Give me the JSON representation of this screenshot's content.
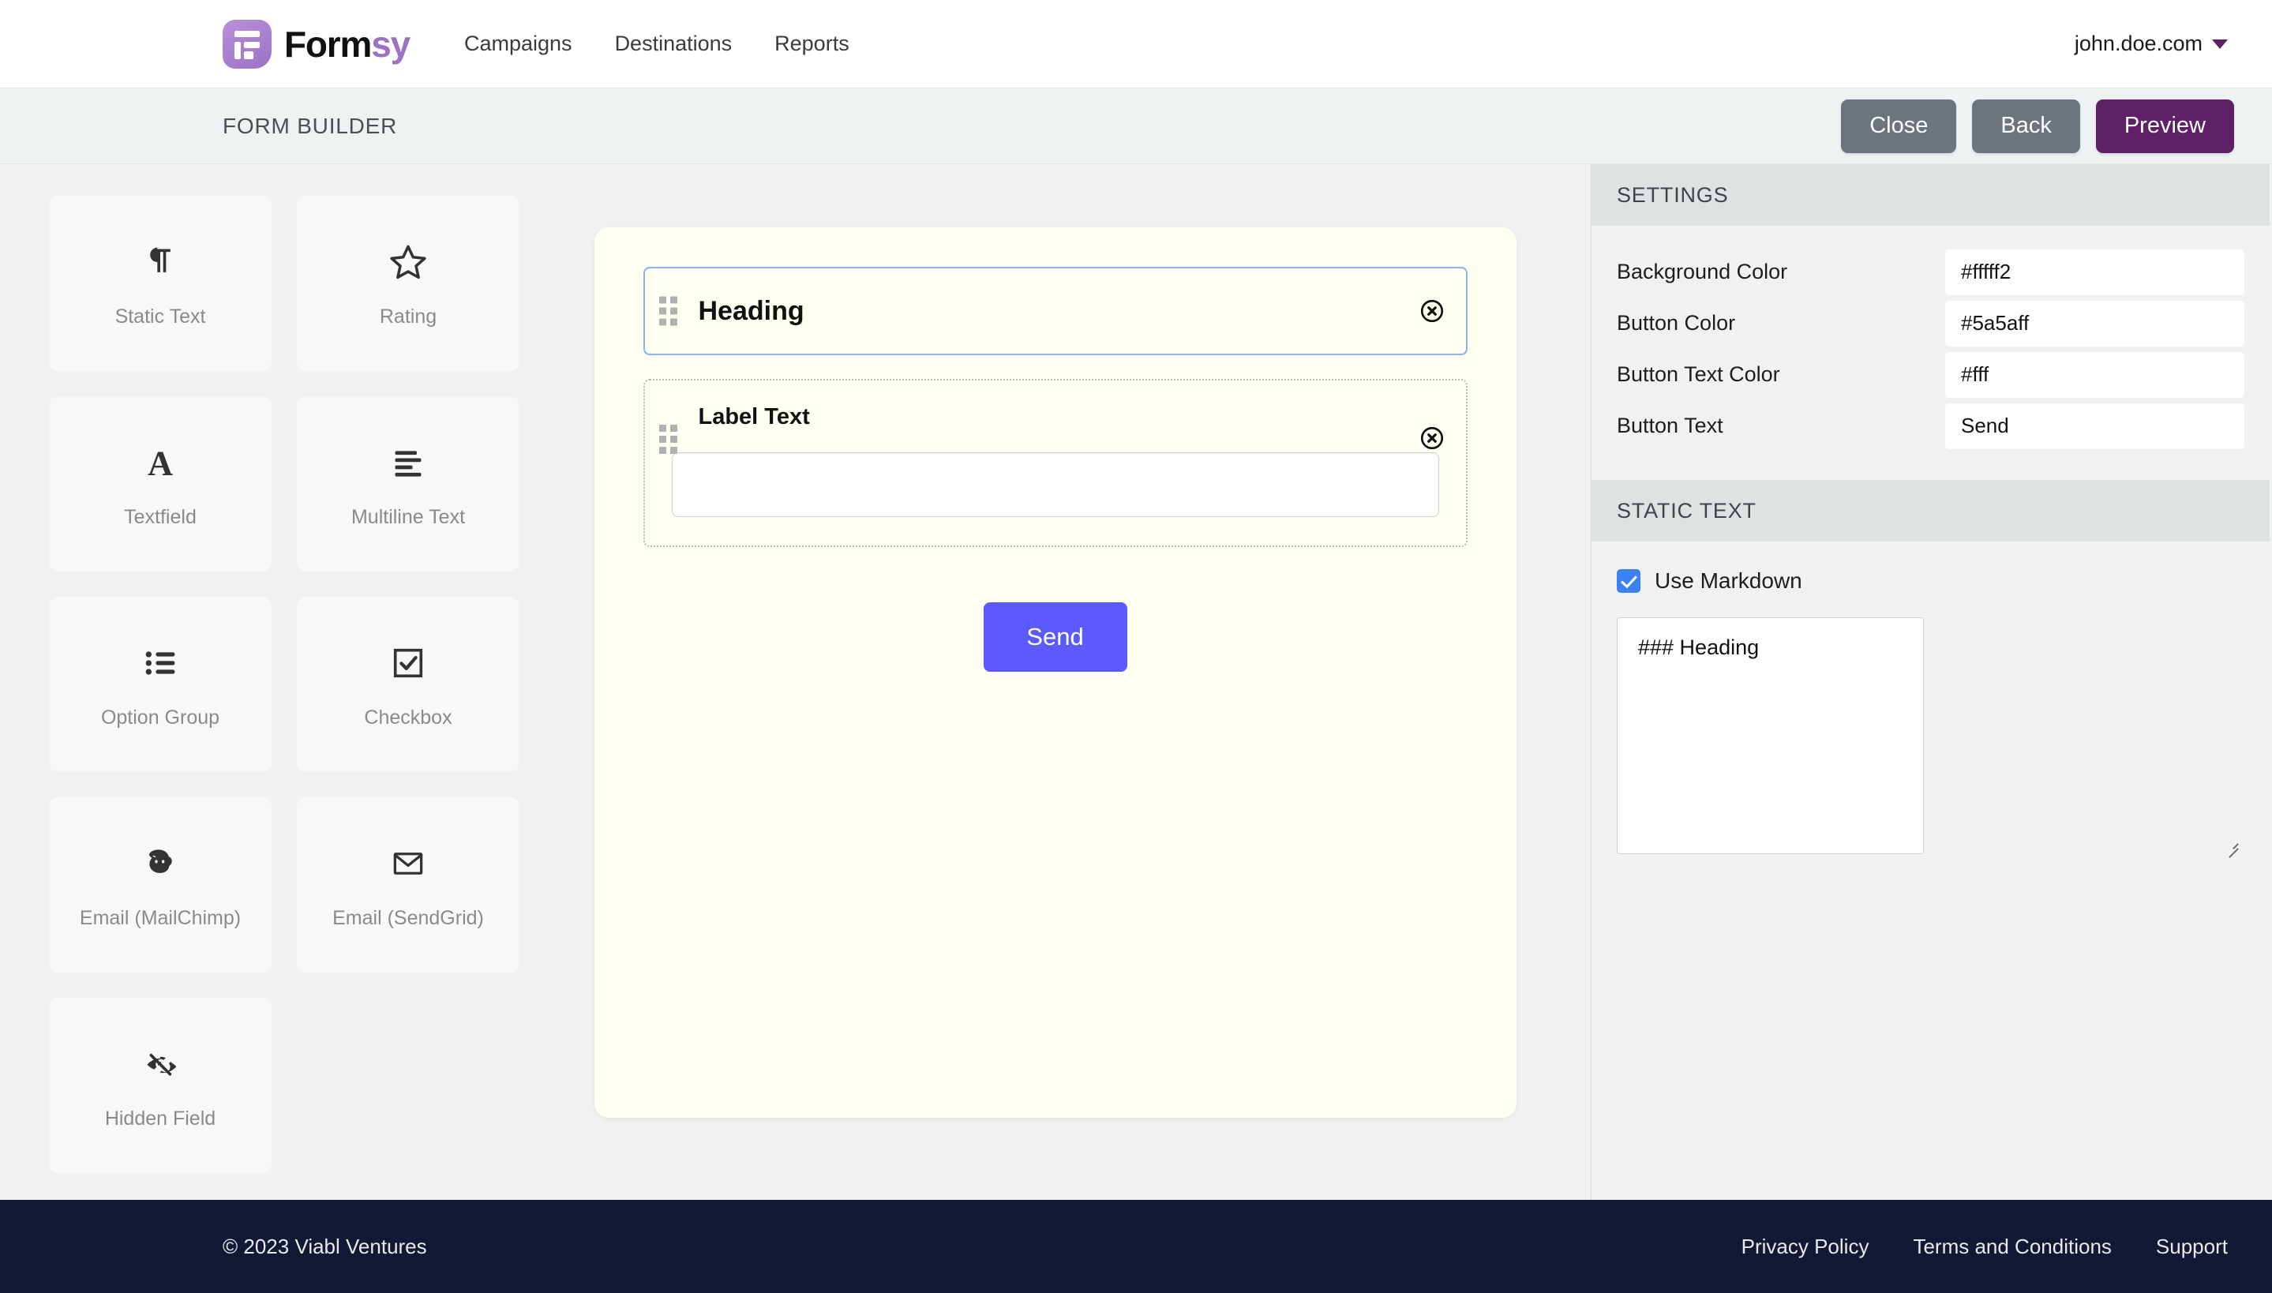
{
  "topnav": {
    "brand_dark": "Form",
    "brand_accent": "sy",
    "links": [
      {
        "label": "Campaigns"
      },
      {
        "label": "Destinations"
      },
      {
        "label": "Reports"
      }
    ],
    "account": "john.doe.com"
  },
  "subheader": {
    "title": "FORM BUILDER",
    "close_label": "Close",
    "back_label": "Back",
    "preview_label": "Preview"
  },
  "palette": {
    "items": [
      {
        "label": "Static Text",
        "icon": "pilcrow-icon"
      },
      {
        "label": "Rating",
        "icon": "star-icon"
      },
      {
        "label": "Textfield",
        "icon": "letter-a-icon"
      },
      {
        "label": "Multiline Text",
        "icon": "text-lines-icon"
      },
      {
        "label": "Option Group",
        "icon": "bullet-list-icon"
      },
      {
        "label": "Checkbox",
        "icon": "checkbox-icon"
      },
      {
        "label": "Email (MailChimp)",
        "icon": "mailchimp-monkey-icon"
      },
      {
        "label": "Email (SendGrid)",
        "icon": "envelope-icon"
      },
      {
        "label": "Hidden Field",
        "icon": "eye-off-icon"
      }
    ]
  },
  "canvas": {
    "background_color": "#fffff2",
    "heading_block": {
      "title": "Heading"
    },
    "label_block": {
      "label": "Label Text",
      "input_value": ""
    },
    "send_label": "Send",
    "send_color": "#5a5aff"
  },
  "settings": {
    "header": "SETTINGS",
    "rows": [
      {
        "label": "Background Color",
        "value": "#fffff2"
      },
      {
        "label": "Button Color",
        "value": "#5a5aff"
      },
      {
        "label": "Button Text Color",
        "value": "#fff"
      },
      {
        "label": "Button Text",
        "value": "Send"
      }
    ]
  },
  "static_text": {
    "header": "STATIC TEXT",
    "markdown_label": "Use Markdown",
    "markdown_checked": true,
    "content": "### Heading"
  },
  "footer": {
    "copyright": "© 2023 Viabl Ventures",
    "links": [
      {
        "label": "Privacy Policy"
      },
      {
        "label": "Terms and Conditions"
      },
      {
        "label": "Support"
      }
    ]
  }
}
